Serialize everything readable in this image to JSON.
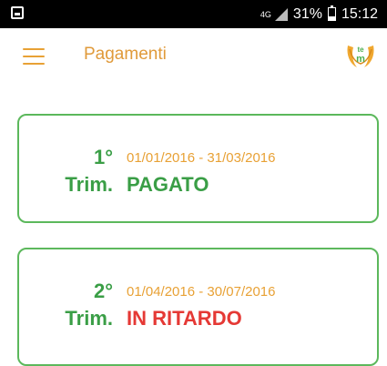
{
  "status_bar": {
    "network": "4G",
    "battery": "31%",
    "time": "15:12"
  },
  "app_bar": {
    "title": "Pagamenti",
    "logo_text": "te m"
  },
  "payments": [
    {
      "quarter_number": "1°",
      "quarter_label": "Trim.",
      "period": "01/01/2016 - 31/03/2016",
      "status": "PAGATO",
      "status_color": "#3a9e46"
    },
    {
      "quarter_number": "2°",
      "quarter_label": "Trim.",
      "period": "01/04/2016 - 30/07/2016",
      "status": "IN RITARDO",
      "status_color": "#e53935"
    }
  ],
  "colors": {
    "accent_orange": "#e8a135",
    "green": "#5cb85c",
    "red": "#e53935"
  },
  "icons": {
    "menu": "hamburger-menu-icon",
    "logo": "app-logo-icon"
  }
}
